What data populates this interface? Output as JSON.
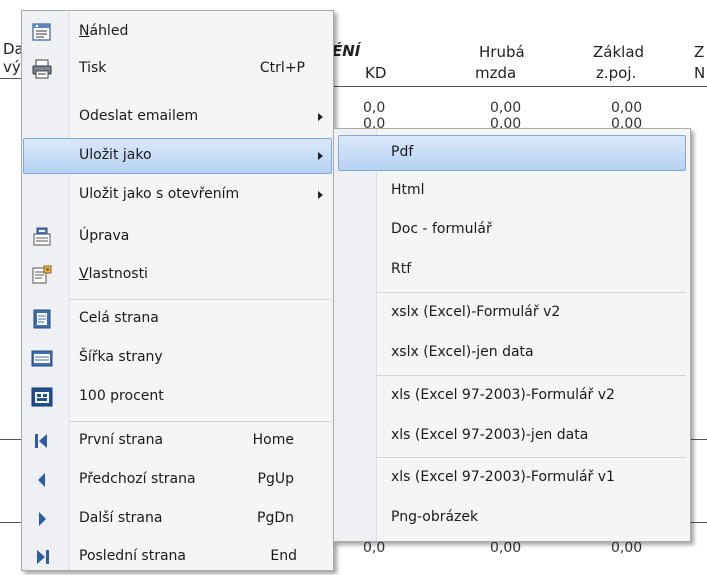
{
  "background": {
    "col_left_top": "Da",
    "col_left_bottom": "vý",
    "col_section": "ÉNÍ",
    "col_kd": "KD",
    "col_hruba_1": "Hrubá",
    "col_hruba_2": "mzda",
    "col_zaklad_1": "Základ",
    "col_zaklad_2": "z.poj.",
    "col_right_1": "Z",
    "col_right_2": "N",
    "row1_kd": "0,0",
    "row1_hruba": "0,00",
    "row1_zaklad": "0,00",
    "row2_kd": "0,0",
    "row2_hruba": "0,00",
    "row2_zaklad": "0,00",
    "rowN_kd": "0,0",
    "rowN_hruba": "0,00",
    "rowN_zaklad": "0,00"
  },
  "menu": {
    "nahled": {
      "prefix": "N",
      "rest": "áhled"
    },
    "tisk": {
      "label": "Tisk",
      "shortcut": "Ctrl+P"
    },
    "odeslat": {
      "label": "Odeslat emailem"
    },
    "ulozit": {
      "label": "Uložit jako"
    },
    "ulozit_otevrenim": {
      "label": "Uložit jako s otevřením"
    },
    "uprava": {
      "label": "Úprava"
    },
    "vlastnosti": {
      "prefix": "V",
      "rest": "lastnosti"
    },
    "cela_strana": {
      "label": "Celá strana"
    },
    "sirka_strany": {
      "label": "Šířka strany"
    },
    "sto_procent": {
      "label": "100 procent"
    },
    "prvni": {
      "label": "První strana",
      "shortcut": "Home"
    },
    "predchozi": {
      "label": "Předchozí strana",
      "shortcut": "PgUp"
    },
    "dalsi": {
      "label": "Další strana",
      "shortcut": "PgDn"
    },
    "posledni": {
      "label": "Poslední strana",
      "shortcut": "End"
    }
  },
  "submenu": {
    "pdf": "Pdf",
    "html": "Html",
    "doc": "Doc - formulář",
    "rtf": "Rtf",
    "xslx_form": "xslx (Excel)-Formulář v2",
    "xslx_data": "xslx (Excel)-jen data",
    "xls_form_v2": "xls (Excel 97-2003)-Formulář v2",
    "xls_data": "xls (Excel 97-2003)-jen data",
    "xls_form_v1": "xls (Excel 97-2003)-Formulář v1",
    "png": "Png-obrázek"
  },
  "colors": {
    "highlight_top": "#dbe9fa",
    "highlight_bottom": "#b6d2f3",
    "highlight_border": "#7fa8d9",
    "menu_bg": "#f5f5f5",
    "nav_icon": "#2d5d9e"
  }
}
